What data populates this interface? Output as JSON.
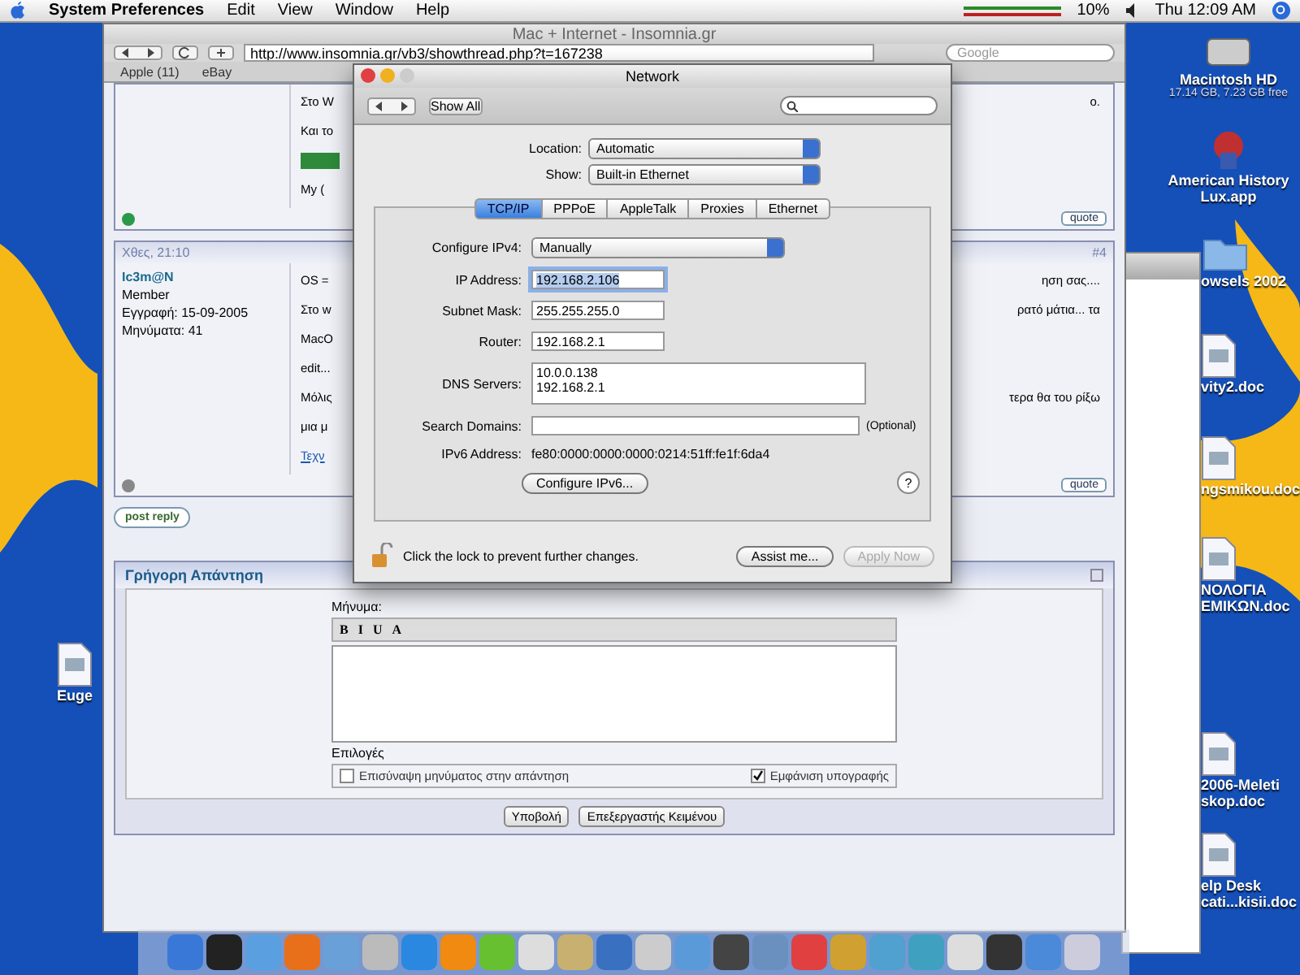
{
  "menu_bar": {
    "app": "System Preferences",
    "menus": [
      "Edit",
      "View",
      "Window",
      "Help"
    ],
    "battery": "10%",
    "clock": "Thu 12:09 AM"
  },
  "browser": {
    "title": "Mac + Internet - Insomnia.gr",
    "url": "http://www.insomnia.gr/vb3/showthread.php?t=167238",
    "search_placeholder": "Google",
    "bookmarks": [
      "Apple (11)",
      "eBay"
    ],
    "post_top": {
      "lines": [
        {
          "left": "Στο W",
          "right": "ο."
        },
        {
          "left": "Και το"
        },
        {
          "kind": "image"
        },
        {
          "left": "My ("
        }
      ],
      "quote": "quote"
    },
    "post": {
      "date": "Χθες, 21:10",
      "number": "#4",
      "user": "Ic3m@N",
      "rank": "Member",
      "joined": "Εγγραφή: 15-09-2005",
      "count": "Μηνύματα: 41",
      "lines": [
        {
          "left": "OS =",
          "right": "ηση σας...."
        },
        {
          "left": "Στο w",
          "right": "ρατό μάτια... τα"
        },
        {
          "left": "MacO"
        },
        {
          "left": "edit..."
        },
        {
          "left": "Μόλις",
          "right": "τερα θα του ρίξω"
        },
        {
          "left": "μια μ"
        },
        {
          "left": "Τεχν",
          "kind": "link"
        }
      ],
      "quote": "quote"
    },
    "post_reply": "post reply",
    "quick_reply": {
      "title": "Γρήγορη Απάντηση",
      "message_label": "Μήνυμα:",
      "toolbar": [
        "B",
        "I",
        "U",
        "A"
      ],
      "options_label": "Επιλογές",
      "options": [
        {
          "label": "Επισύναψη μηνύματος στην απάντηση",
          "checked": false
        },
        {
          "label": "Εμφάνιση υπογραφής",
          "checked": true
        }
      ],
      "buttons": [
        "Υποβολή",
        "Επεξεργαστής Κειμένου"
      ]
    }
  },
  "network": {
    "title": "Network",
    "show_all": "Show All",
    "location_label": "Location:",
    "location": "Automatic",
    "show_label": "Show:",
    "show": "Built-in Ethernet",
    "tabs": [
      {
        "label": "TCP/IP",
        "selected": true
      },
      {
        "label": "PPPoE",
        "selected": false
      },
      {
        "label": "AppleTalk",
        "selected": false
      },
      {
        "label": "Proxies",
        "selected": false
      },
      {
        "label": "Ethernet",
        "selected": false
      }
    ],
    "configure_label": "Configure IPv4:",
    "configure": "Manually",
    "fields": [
      {
        "label": "IP Address:",
        "value": "192.168.2.106",
        "focused": true
      },
      {
        "label": "Subnet Mask:",
        "value": "255.255.255.0",
        "focused": false
      },
      {
        "label": "Router:",
        "value": "192.168.2.1",
        "focused": false
      }
    ],
    "dns_label": "DNS Servers:",
    "dns": [
      "10.0.0.138",
      "192.168.2.1"
    ],
    "search_domains_label": "Search Domains:",
    "optional": "(Optional)",
    "ipv6_label": "IPv6 Address:",
    "ipv6": "fe80:0000:0000:0000:0214:51ff:fe1f:6da4",
    "configure_ipv6": "Configure IPv6...",
    "help": "?",
    "lock_text": "Click the lock to prevent further changes.",
    "assist": "Assist me...",
    "apply": {
      "label": "Apply Now",
      "disabled": true
    }
  },
  "desktop_icons": [
    {
      "label": "Macintosh HD",
      "detail": "17.14 GB, 7.23 GB free",
      "kind": "disk"
    },
    {
      "label": "American History Lux.app",
      "kind": "app"
    },
    {
      "label": "owsels 2002",
      "kind": "folder"
    },
    {
      "label": "vity2.doc",
      "kind": "doc"
    },
    {
      "label": "ngsmikou.doc",
      "kind": "doc"
    },
    {
      "label": "ΝΟΛΟΓΙΑ ΕΜΙΚΩΝ.doc",
      "kind": "doc"
    },
    {
      "label": "2006-Meleti skop.doc",
      "kind": "doc"
    },
    {
      "label": "elp Desk cati...kisii.doc",
      "kind": "doc"
    }
  ],
  "left_icon": {
    "label": "Euge",
    "kind": "doc"
  }
}
